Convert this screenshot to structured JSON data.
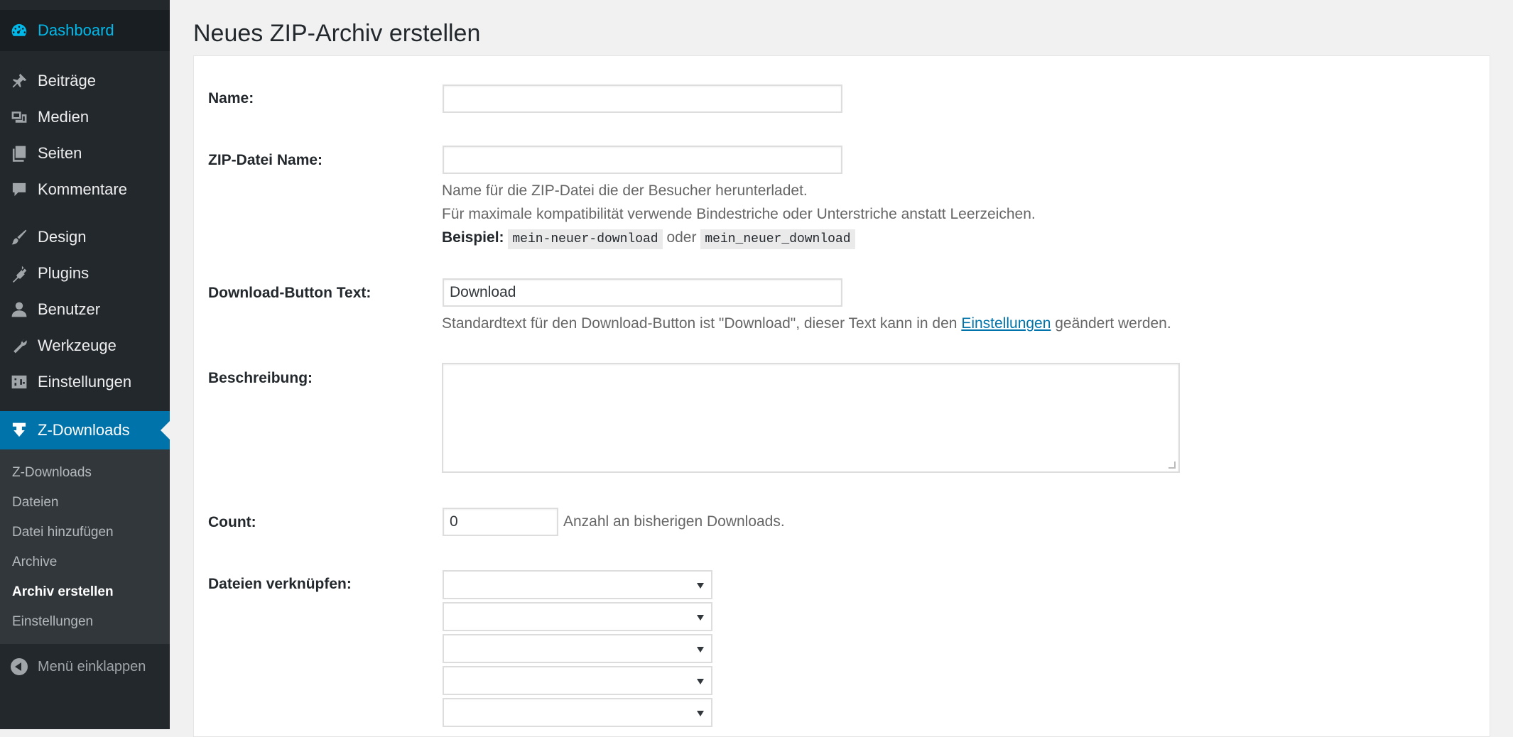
{
  "sidebar": {
    "dashboard": "Dashboard",
    "items": [
      {
        "label": "Beiträge",
        "icon": "pin-icon"
      },
      {
        "label": "Medien",
        "icon": "media-icon"
      },
      {
        "label": "Seiten",
        "icon": "pages-icon"
      },
      {
        "label": "Kommentare",
        "icon": "comment-icon"
      },
      {
        "label": "Design",
        "icon": "brush-icon"
      },
      {
        "label": "Plugins",
        "icon": "plugin-icon"
      },
      {
        "label": "Benutzer",
        "icon": "user-icon"
      },
      {
        "label": "Werkzeuge",
        "icon": "wrench-icon"
      },
      {
        "label": "Einstellungen",
        "icon": "settings-icon"
      }
    ],
    "current": "Z-Downloads",
    "submenu": [
      "Z-Downloads",
      "Dateien",
      "Datei hinzufügen",
      "Archive",
      "Archiv erstellen",
      "Einstellungen"
    ],
    "submenu_active": "Archiv erstellen",
    "collapse": "Menü einklappen"
  },
  "page": {
    "title": "Neues ZIP-Archiv erstellen"
  },
  "form": {
    "name_label": "Name:",
    "name_value": "",
    "zip_label": "ZIP-Datei Name:",
    "zip_value": "",
    "zip_help_1": "Name für die ZIP-Datei die der Besucher herunterladet.",
    "zip_help_2": "Für maximale kompatibilität verwende Bindestriche oder Unterstriche anstatt Leerzeichen.",
    "zip_example_label": "Beispiel:",
    "zip_example_1": "mein-neuer-download",
    "zip_example_or": "oder",
    "zip_example_2": "mein_neuer_download",
    "button_label": "Download-Button Text:",
    "button_value": "Download",
    "button_help_pre": "Standardtext für den Download-Button ist \"Download\", dieser Text kann in den",
    "button_help_link": "Einstellungen",
    "button_help_post": "geändert werden.",
    "desc_label": "Beschreibung:",
    "desc_value": "",
    "count_label": "Count:",
    "count_value": "0",
    "count_help": "Anzahl an bisherigen Downloads.",
    "files_label": "Dateien verknüpfen:",
    "selects": [
      "",
      "",
      "",
      "",
      ""
    ]
  }
}
